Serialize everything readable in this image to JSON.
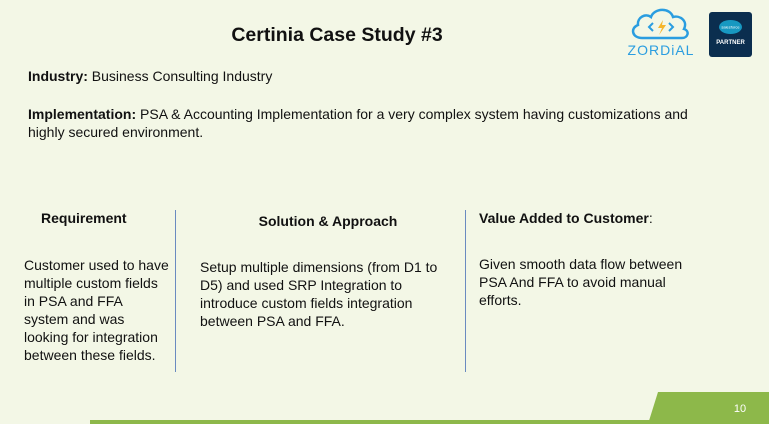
{
  "slide": {
    "title": "Certinia Case Study #3",
    "industry_label": "Industry:",
    "industry_value": " Business Consulting Industry",
    "implementation_label": "Implementation:",
    "implementation_value": " PSA & Accounting Implementation for a very complex system having customizations and highly secured environment.",
    "page_number": "10"
  },
  "columns": [
    {
      "heading": "Requirement",
      "body": "Customer used to have multiple custom fields in PSA and FFA system and was looking for integration between these fields."
    },
    {
      "heading": "Solution & Approach",
      "body": "Setup multiple dimensions (from D1 to D5) and used SRP Integration to introduce custom fields integration between PSA and FFA."
    },
    {
      "heading": "Value Added to Customer",
      "heading_suffix": ":",
      "body": "Given smooth data flow between PSA And FFA to avoid manual efforts."
    }
  ],
  "logos": {
    "brand_text": "ZORDiAL",
    "partner_cloud_text": "salesforce",
    "partner_text": "PARTNER"
  },
  "colors": {
    "background": "#f3f7e6",
    "accent_green": "#8db84a",
    "divider_blue": "#6a8bc0",
    "brand_blue": "#2a9de0",
    "partner_navy": "#0b2e4f"
  }
}
